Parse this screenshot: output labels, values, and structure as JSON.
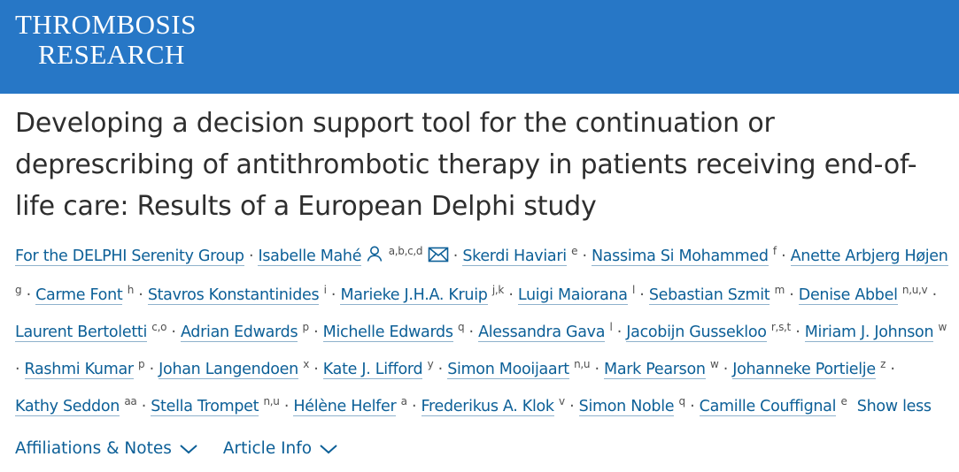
{
  "journal": {
    "line1": "THROMBOSIS",
    "line2": "RESEARCH",
    "brand_color": "#2777c6"
  },
  "article": {
    "title": "Developing a decision support tool for the continuation or deprescribing of antithrombotic therapy in patients receiving end-of-life care: Results of a European Delphi study"
  },
  "authors": [
    {
      "name": "For the DELPHI Serenity Group",
      "sup": ""
    },
    {
      "name": "Isabelle Mahé",
      "sup": "a,b,c,d",
      "icons": [
        "person-icon",
        "email-icon"
      ]
    },
    {
      "name": "Skerdi Haviari",
      "sup": "e"
    },
    {
      "name": "Nassima Si Mohammed",
      "sup": "f"
    },
    {
      "name": "Anette Arbjerg Højen",
      "sup": "g"
    },
    {
      "name": "Carme Font",
      "sup": "h"
    },
    {
      "name": "Stavros Konstantinides",
      "sup": "i"
    },
    {
      "name": "Marieke J.H.A. Kruip",
      "sup": "j,k"
    },
    {
      "name": "Luigi Maiorana",
      "sup": "l"
    },
    {
      "name": "Sebastian Szmit",
      "sup": "m"
    },
    {
      "name": "Denise Abbel",
      "sup": "n,u,v"
    },
    {
      "name": "Laurent Bertoletti",
      "sup": "c,o"
    },
    {
      "name": "Adrian Edwards",
      "sup": "p"
    },
    {
      "name": "Michelle Edwards",
      "sup": "q"
    },
    {
      "name": "Alessandra Gava",
      "sup": "l"
    },
    {
      "name": "Jacobijn Gussekloo",
      "sup": "r,s,t"
    },
    {
      "name": "Miriam J. Johnson",
      "sup": "w"
    },
    {
      "name": "Rashmi Kumar",
      "sup": "p"
    },
    {
      "name": "Johan Langendoen",
      "sup": "x"
    },
    {
      "name": "Kate J. Lifford",
      "sup": "y"
    },
    {
      "name": "Simon Mooijaart",
      "sup": "n,u"
    },
    {
      "name": "Mark Pearson",
      "sup": "w"
    },
    {
      "name": "Johanneke Portielje",
      "sup": "z"
    },
    {
      "name": "Kathy Seddon",
      "sup": "aa"
    },
    {
      "name": "Stella Trompet",
      "sup": "n,u"
    },
    {
      "name": "Hélène Helfer",
      "sup": "a"
    },
    {
      "name": "Frederikus A. Klok",
      "sup": "v"
    },
    {
      "name": "Simon Noble",
      "sup": "q"
    },
    {
      "name": "Camille Couffignal",
      "sup": "e"
    }
  ],
  "show_less_label": "Show less",
  "toggles": {
    "affiliations_label": "Affiliations & Notes",
    "article_info_label": "Article Info"
  }
}
